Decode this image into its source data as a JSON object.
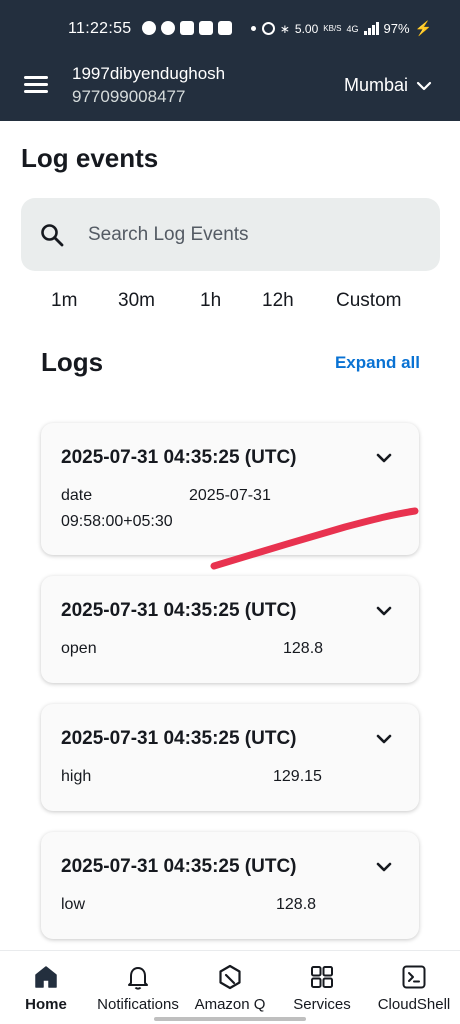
{
  "status_bar": {
    "time": "11:22:55",
    "net_speed": "5.00",
    "net_unit": "KB/S",
    "net_type": "4G",
    "battery": "97%"
  },
  "header": {
    "account_name": "1997dibyendughosh",
    "account_id": "977099008477",
    "region": "Mumbai"
  },
  "page": {
    "title": "Log events",
    "search_placeholder": "Search Log Events",
    "time_ranges": [
      "1m",
      "30m",
      "1h",
      "12h",
      "Custom"
    ],
    "logs_title": "Logs",
    "expand_all": "Expand all"
  },
  "log_entries": [
    {
      "timestamp": "2025-07-31 04:35:25 (UTC)",
      "key": "date",
      "value": "2025-07-31",
      "value_cont": "09:58:00+05:30"
    },
    {
      "timestamp": "2025-07-31 04:35:25 (UTC)",
      "key": "open",
      "value": "128.8"
    },
    {
      "timestamp": "2025-07-31 04:35:25 (UTC)",
      "key": "high",
      "value": "129.15"
    },
    {
      "timestamp": "2025-07-31 04:35:25 (UTC)",
      "key": "low",
      "value": "128.8"
    }
  ],
  "bottom_nav": [
    {
      "label": "Home",
      "icon": "home-icon",
      "active": true
    },
    {
      "label": "Notifications",
      "icon": "bell-icon",
      "active": false
    },
    {
      "label": "Amazon Q",
      "icon": "amazon-q-icon",
      "active": false
    },
    {
      "label": "Services",
      "icon": "grid-icon",
      "active": false
    },
    {
      "label": "CloudShell",
      "icon": "terminal-icon",
      "active": false
    }
  ],
  "colors": {
    "header_bg": "#232f3e",
    "link": "#0972d3",
    "annotation_stroke": "#e8324f"
  }
}
